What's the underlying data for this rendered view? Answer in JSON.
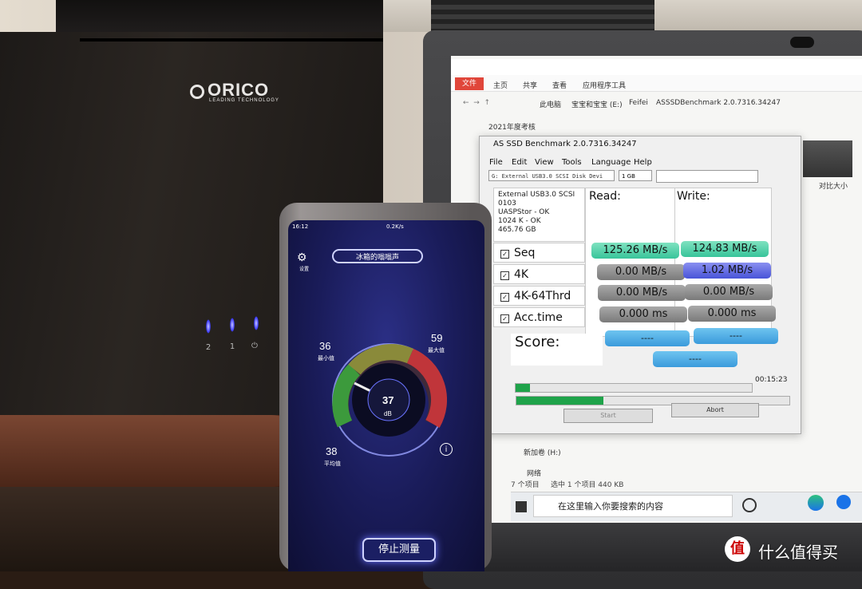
{
  "enclosure": {
    "brand": "ORICO",
    "tagline": "LEADING TECHNOLOGY",
    "bay_labels": [
      "2",
      "1"
    ],
    "led_color": "#3b3bff"
  },
  "explorer": {
    "ribbon_tabs": [
      "文件",
      "主页",
      "共享",
      "查看",
      "应用程序工具"
    ],
    "breadcrumb": [
      "此电脑",
      "宝宝和宝宝 (E:)",
      "Feifei",
      "ASSSDBenchmark 2.0.7316.34247"
    ],
    "folder_item": "2021年度考核",
    "thumb_labels": [
      "大小",
      "对比大小"
    ],
    "sidebar_items": [
      "新加卷 (H:)",
      "网络"
    ],
    "status_text": [
      "7 个项目",
      "选中 1 个项目 440 KB"
    ],
    "search_placeholder": "在这里输入你要搜索的内容"
  },
  "asssd": {
    "title": "AS SSD Benchmark 2.0.7316.34247",
    "menu": [
      "File",
      "Edit",
      "View",
      "Tools",
      "Language",
      "Help"
    ],
    "drive_select": "G: External USB3.0 SCSI Disk Devi",
    "size_select": "1 GB",
    "drive_info": [
      "External USB3.0 SCSI",
      "0103",
      "UASPStor - OK",
      "1024 K - OK",
      "465.76 GB"
    ],
    "read_header": "Read:",
    "write_header": "Write:",
    "rows": [
      {
        "label": "Seq",
        "read": "125.26 MB/s",
        "write": "124.83 MB/s"
      },
      {
        "label": "4K",
        "read": "0.00 MB/s",
        "write": "1.02 MB/s"
      },
      {
        "label": "4K-64Thrd",
        "read": "0.00 MB/s",
        "write": "0.00 MB/s"
      },
      {
        "label": "Acc.time",
        "read": "0.000 ms",
        "write": "0.000 ms"
      }
    ],
    "score_label": "Score:",
    "score_read": "----",
    "score_write": "----",
    "score_total": "----",
    "elapsed": "00:15:23",
    "progress_top": 0.06,
    "progress_bottom": 0.32,
    "start_label": "Start",
    "abort_label": "Abort",
    "colors": {
      "seq": "#38c49a",
      "write4k": "#4854d8",
      "gray": "#7a7a7a",
      "score": "#3b9bdc",
      "progress": "#1fa34a"
    }
  },
  "phone": {
    "time": "16:12",
    "net": "0.2K/s",
    "settings_label": "设置",
    "mode_label": "冰箱的嗡嗡声",
    "min_value": "36",
    "min_label": "最小值",
    "max_value": "59",
    "max_label": "最大值",
    "avg_value": "38",
    "avg_label": "平均值",
    "current_value": "37",
    "unit": "dB",
    "stop_button": "停止测量"
  },
  "watermark": {
    "mark": "值",
    "text": "什么值得买"
  }
}
